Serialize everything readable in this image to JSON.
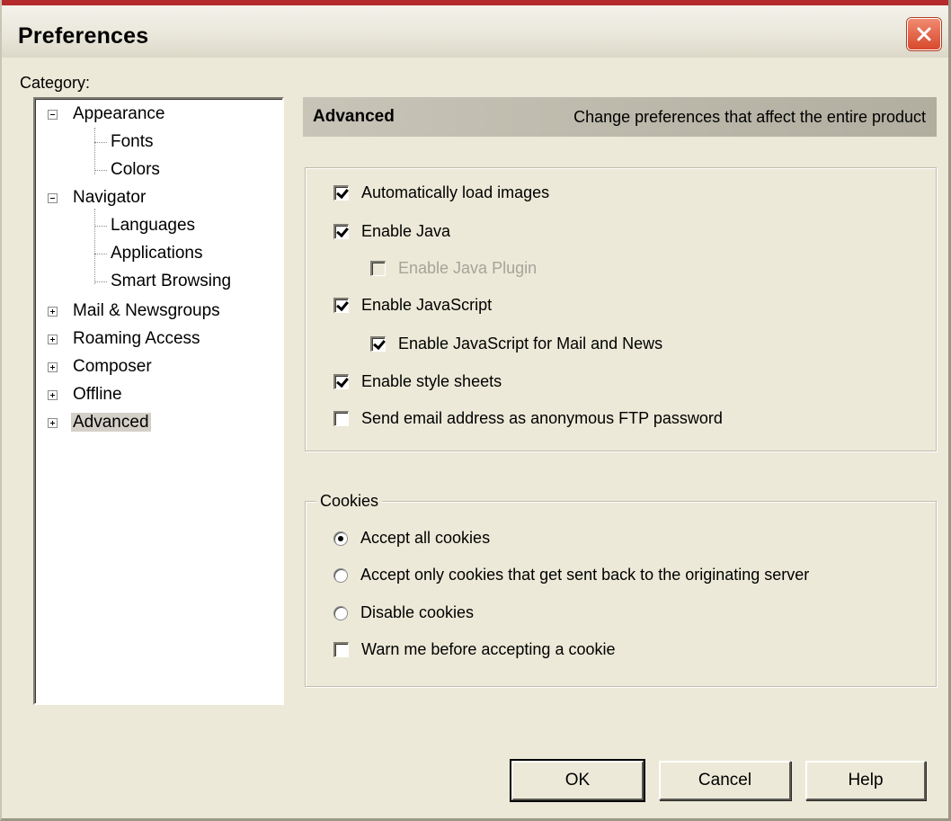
{
  "window": {
    "title": "Preferences"
  },
  "category_label": "Category:",
  "tree": [
    {
      "label": "Appearance",
      "expander": "minus"
    },
    {
      "label": "Fonts"
    },
    {
      "label": "Colors"
    },
    {
      "label": "Navigator",
      "expander": "minus"
    },
    {
      "label": "Languages"
    },
    {
      "label": "Applications"
    },
    {
      "label": "Smart Browsing"
    },
    {
      "label": "Mail & Newsgroups",
      "expander": "plus"
    },
    {
      "label": "Roaming Access",
      "expander": "plus"
    },
    {
      "label": "Composer",
      "expander": "plus"
    },
    {
      "label": "Offline",
      "expander": "plus"
    },
    {
      "label": "Advanced",
      "expander": "plus",
      "selected": true
    }
  ],
  "panel": {
    "title": "Advanced",
    "description": "Change preferences that affect the entire product"
  },
  "options": [
    {
      "label": "Automatically load images",
      "checked": true
    },
    {
      "label": "Enable Java",
      "checked": true
    },
    {
      "label": "Enable Java Plugin",
      "checked": false,
      "disabled": true
    },
    {
      "label": "Enable JavaScript",
      "checked": true
    },
    {
      "label": "Enable JavaScript for Mail and News",
      "checked": true
    },
    {
      "label": "Enable style sheets",
      "checked": true
    },
    {
      "label": "Send email address as anonymous FTP password",
      "checked": false
    }
  ],
  "cookies": {
    "legend": "Cookies",
    "radios": [
      {
        "label": "Accept all cookies",
        "selected": true
      },
      {
        "label": "Accept only cookies that get sent back to the originating server",
        "selected": false
      },
      {
        "label": "Disable cookies",
        "selected": false
      }
    ],
    "warn": {
      "label": "Warn me before accepting a cookie",
      "checked": false
    }
  },
  "buttons": {
    "ok": "OK",
    "cancel": "Cancel",
    "help": "Help"
  }
}
